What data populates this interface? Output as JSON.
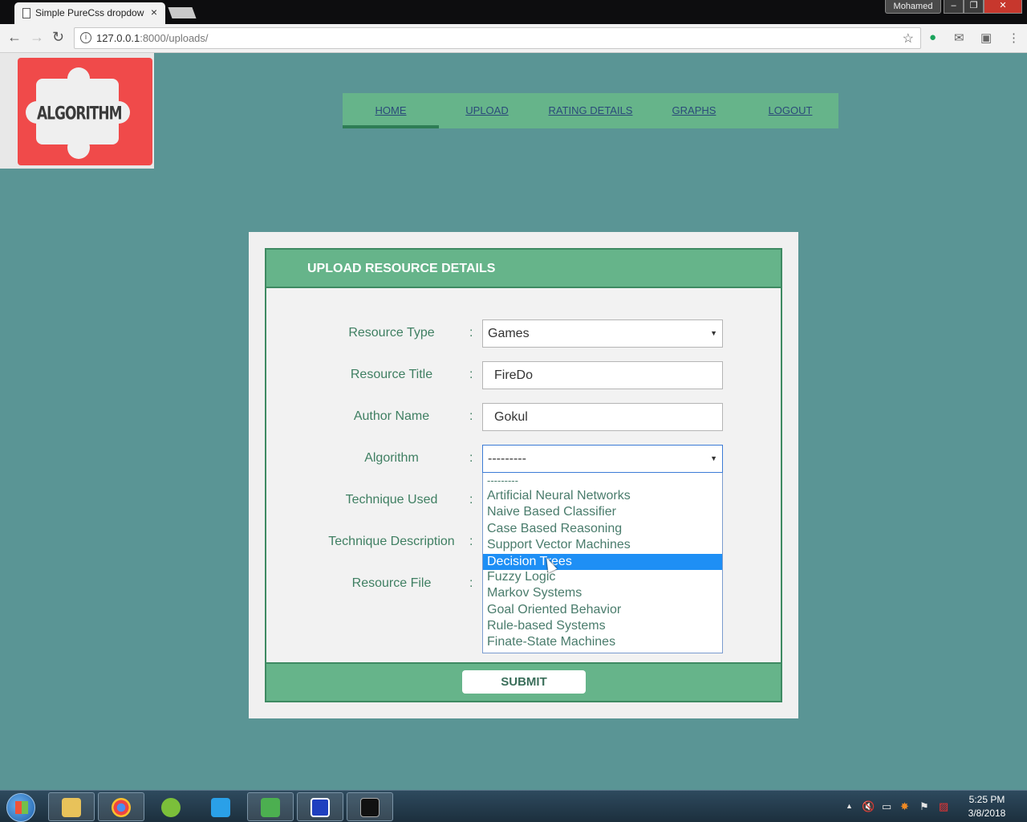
{
  "browser": {
    "tab_title": "Simple PureCss dropdow",
    "url_host": "127.0.0.1",
    "url_path": ":8000/uploads/",
    "user_name": "Mohamed"
  },
  "logo": {
    "text": "ALGORITHM"
  },
  "nav": {
    "items": [
      "HOME",
      "UPLOAD",
      "RATING DETAILS",
      "GRAPHS",
      "LOGOUT"
    ],
    "active_index": 0
  },
  "form": {
    "title": "UPLOAD RESOURCE DETAILS",
    "colon": ":",
    "labels": {
      "resource_type": "Resource Type",
      "resource_title": "Resource Title",
      "author_name": "Author Name",
      "algorithm": "Algorithm",
      "technique_used": "Technique Used",
      "technique_description": "Technique Description",
      "resource_file": "Resource File"
    },
    "values": {
      "resource_type": "Games",
      "resource_title": "FireDo",
      "author_name": "Gokul",
      "algorithm": "---------"
    },
    "algorithm_options": [
      "---------",
      "Artificial Neural Networks",
      "Naive Based Classifier",
      "Case Based Reasoning",
      "Support Vector Machines",
      "Decision Trees",
      "Fuzzy Logic",
      "Markov Systems",
      "Goal Oriented Behavior",
      "Rule-based Systems",
      "Finate-State Machines"
    ],
    "highlighted_option": "Decision Trees",
    "submit_label": "SUBMIT"
  },
  "taskbar": {
    "time": "5:25 PM",
    "date": "3/8/2018"
  },
  "colors": {
    "page_bg": "#5a9595",
    "accent_green": "#66b48a",
    "dark_green": "#3e8a62",
    "highlight_blue": "#1e8ff5"
  }
}
